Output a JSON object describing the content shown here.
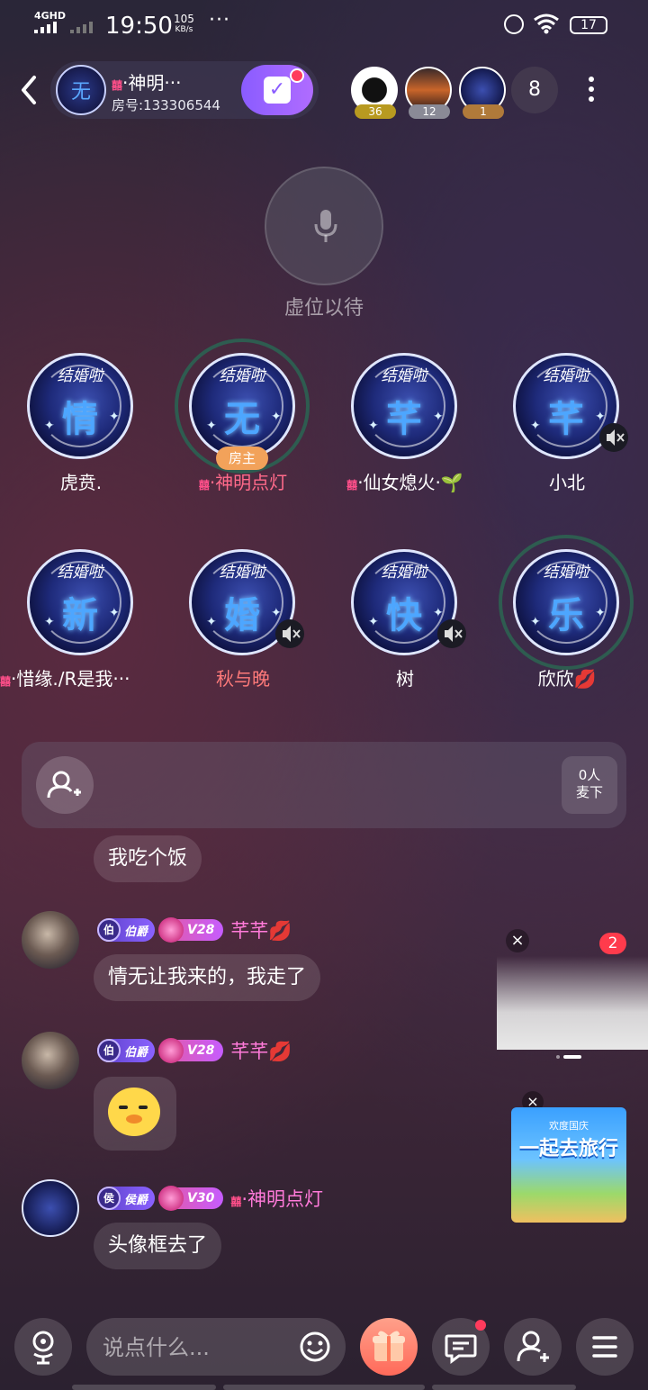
{
  "status_bar": {
    "network": "4GHD",
    "time": "19:50",
    "speed_value": "105",
    "speed_unit": "KB/s",
    "more": "···",
    "battery": "17"
  },
  "header": {
    "room_tag": "囍",
    "room_name": "·神明···",
    "room_id": "房号:133306544",
    "room_avatar_char": "无",
    "viewers": [
      {
        "badge": "36",
        "badge_color": "#b89a20"
      },
      {
        "badge": "12",
        "badge_color": "#8a8a96"
      },
      {
        "badge": "1",
        "badge_color": "#b07a3a"
      }
    ],
    "viewer_count": "8"
  },
  "host_seat": {
    "label": "虚位以待"
  },
  "seats": [
    {
      "char": "情",
      "name": "虎贲.",
      "tag": "",
      "name_color": "#ffffff"
    },
    {
      "char": "无",
      "name": "·神明点灯",
      "tag": "囍",
      "name_color": "#ff6a8a",
      "owner_badge": "房主"
    },
    {
      "char": "芊",
      "name": "·仙女熄火·🌱",
      "tag": "囍",
      "name_color": "#ffffff"
    },
    {
      "char": "芊",
      "name": "小北",
      "tag": "",
      "name_color": "#ffffff"
    },
    {
      "char": "新",
      "name": "·惜缘./R是我···",
      "tag": "囍",
      "name_color": "#ffffff"
    },
    {
      "char": "婚",
      "name": "秋与晚",
      "tag": "",
      "name_color": "#ff7a7a"
    },
    {
      "char": "快",
      "name": "树",
      "tag": "",
      "name_color": "#ffffff"
    },
    {
      "char": "乐",
      "name": "欣欣💋",
      "tag": "",
      "name_color": "#ffffff"
    }
  ],
  "seat_avatar_caption": "结婚啦",
  "queue": {
    "count_line1": "0人",
    "count_line2": "麦下"
  },
  "chat": [
    {
      "type": "text",
      "text": "我吃个饭"
    },
    {
      "type": "text",
      "rank_char": "伯",
      "rank": "伯爵",
      "vip": "V28",
      "user": "芊芊💋",
      "text": "情无让我来的，我走了"
    },
    {
      "type": "emoji",
      "rank_char": "伯",
      "rank": "伯爵",
      "vip": "V28",
      "user": "芊芊💋"
    },
    {
      "type": "text",
      "rank_char": "侯",
      "rank": "侯爵",
      "vip": "V30",
      "user_tag": "囍",
      "user": "·神明点灯",
      "text": "头像框去了"
    }
  ],
  "promos": {
    "promo1_badge": "2",
    "promo2_sub": "欢度国庆",
    "promo2_title": "一起去旅行",
    "close": "×"
  },
  "bottom": {
    "input_placeholder": "说点什么..."
  }
}
